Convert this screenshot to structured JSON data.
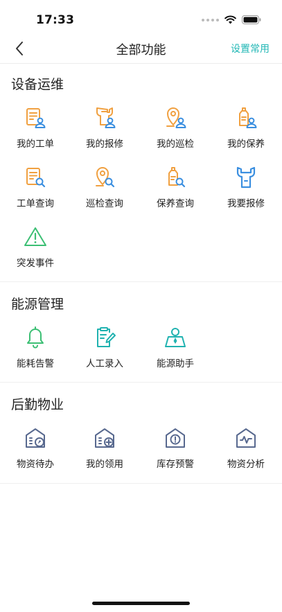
{
  "status_bar": {
    "time": "17:33"
  },
  "nav": {
    "title": "全部功能",
    "action": "设置常用"
  },
  "sections": [
    {
      "title": "设备运维",
      "items": [
        {
          "label": "我的工单",
          "icon": "work-order-user-icon"
        },
        {
          "label": "我的报修",
          "icon": "repair-user-icon"
        },
        {
          "label": "我的巡检",
          "icon": "inspection-user-icon"
        },
        {
          "label": "我的保养",
          "icon": "maintenance-user-icon"
        },
        {
          "label": "工单查询",
          "icon": "work-order-search-icon"
        },
        {
          "label": "巡检查询",
          "icon": "inspection-search-icon"
        },
        {
          "label": "保养查询",
          "icon": "maintenance-search-icon"
        },
        {
          "label": "我要报修",
          "icon": "wrench-icon"
        },
        {
          "label": "突发事件",
          "icon": "warning-triangle-icon"
        }
      ]
    },
    {
      "title": "能源管理",
      "items": [
        {
          "label": "能耗告警",
          "icon": "bell-icon"
        },
        {
          "label": "人工录入",
          "icon": "clipboard-edit-icon"
        },
        {
          "label": "能源助手",
          "icon": "assistant-icon"
        }
      ]
    },
    {
      "title": "后勤物业",
      "items": [
        {
          "label": "物资待办",
          "icon": "supplies-todo-icon"
        },
        {
          "label": "我的领用",
          "icon": "supplies-receive-icon"
        },
        {
          "label": "库存预警",
          "icon": "inventory-alert-icon"
        },
        {
          "label": "物资分析",
          "icon": "supplies-analysis-icon"
        }
      ]
    }
  ],
  "colors": {
    "accent": "#21b7b5",
    "orange": "#f0a040",
    "blue": "#3b8fe0",
    "green": "#3cbf74",
    "teal": "#20b2b0",
    "slate": "#58698f"
  }
}
